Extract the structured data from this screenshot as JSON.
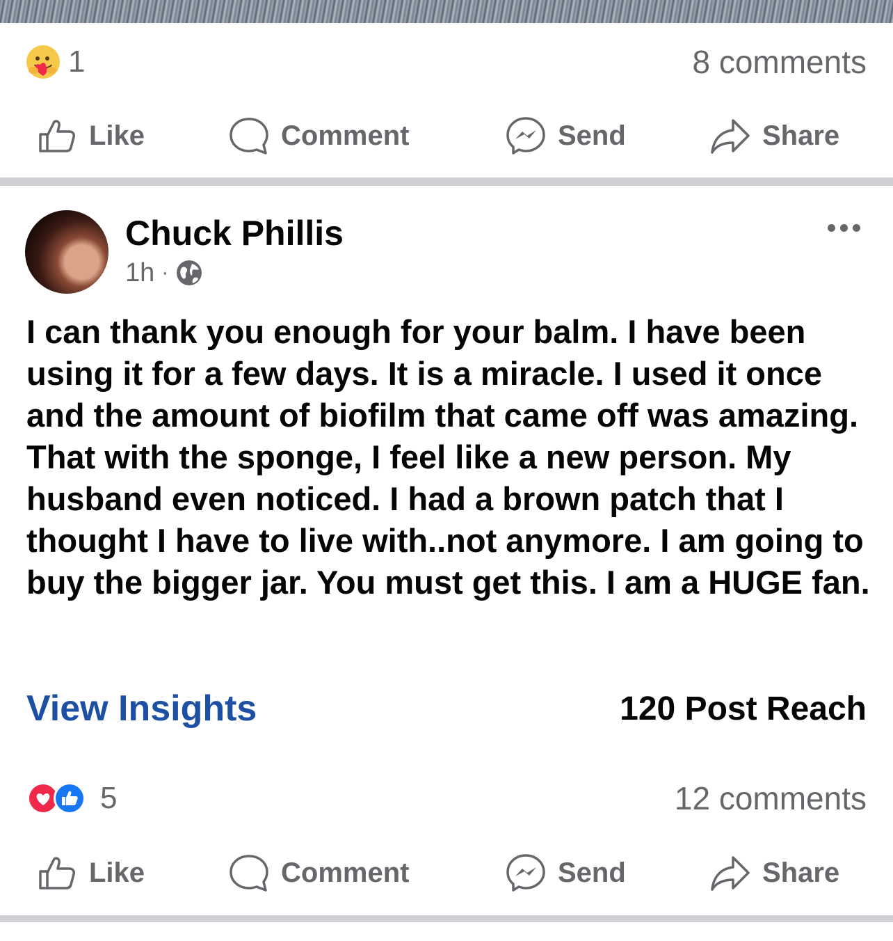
{
  "post_top": {
    "reaction_icon": "care-emoji",
    "reaction_count": "1",
    "comments": "8 comments",
    "actions": {
      "like": "Like",
      "comment": "Comment",
      "send": "Send",
      "share": "Share"
    }
  },
  "post": {
    "author": "Chuck Phillis",
    "time": "1h",
    "separator": "·",
    "privacy_icon": "globe-icon",
    "text": "I can thank you enough for your balm. I have been using it for a few days. It is a miracle. I used it once and the amount of biofilm that came off was amazing. That with the sponge, I feel like a new person. My husband even noticed. I had a brown patch that I thought I have to live with..not anymore. I am going to buy the bigger jar. You must get this. I am a HUGE fan.",
    "insights_label": "View Insights",
    "reach": "120 Post Reach",
    "reaction_icons": [
      "love-emoji",
      "like-emoji"
    ],
    "reaction_count": "5",
    "comments": "12 comments",
    "actions": {
      "like": "Like",
      "comment": "Comment",
      "send": "Send",
      "share": "Share"
    }
  },
  "colors": {
    "link": "#1d4fa3",
    "muted": "#65676b",
    "divider": "#ced0d4",
    "love": "#f0284a",
    "like": "#1877f2"
  }
}
